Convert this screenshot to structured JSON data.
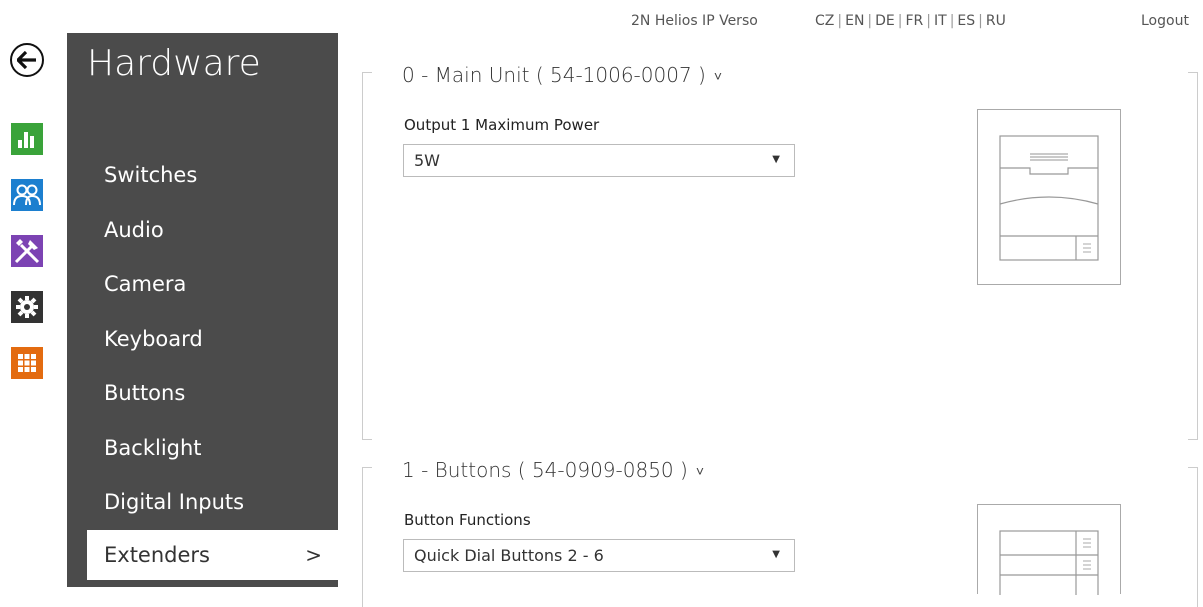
{
  "topbar": {
    "device_name": "2N Helios IP Verso",
    "languages": [
      "CZ",
      "EN",
      "DE",
      "FR",
      "IT",
      "ES",
      "RU"
    ],
    "logout": "Logout"
  },
  "rail": {
    "back_icon": "back-arrow-icon",
    "icons": [
      "status-chart-icon",
      "directory-users-icon",
      "hardware-tools-icon",
      "system-gear-icon",
      "services-grid-icon"
    ],
    "colors": {
      "status": "#3aa33a",
      "directory": "#1c7fcf",
      "hardware": "#7c43b3",
      "system": "#333333",
      "services": "#e36b10"
    }
  },
  "sidebar": {
    "title": "Hardware",
    "items": [
      {
        "label": "Switches"
      },
      {
        "label": "Audio"
      },
      {
        "label": "Camera"
      },
      {
        "label": "Keyboard"
      },
      {
        "label": "Buttons"
      },
      {
        "label": "Backlight"
      },
      {
        "label": "Digital Inputs"
      },
      {
        "label": "Extenders",
        "chevron": ">"
      }
    ],
    "active": "Extenders"
  },
  "sections": [
    {
      "title": "0 - Main Unit ( 54-1006-0007 )",
      "caret": "˅",
      "field_label": "Output 1 Maximum Power",
      "field_value": "5W"
    },
    {
      "title": "1 - Buttons ( 54-0909-0850 )",
      "caret": "˅",
      "field_label": "Button Functions",
      "field_value": "Quick Dial Buttons 2 - 6"
    }
  ]
}
